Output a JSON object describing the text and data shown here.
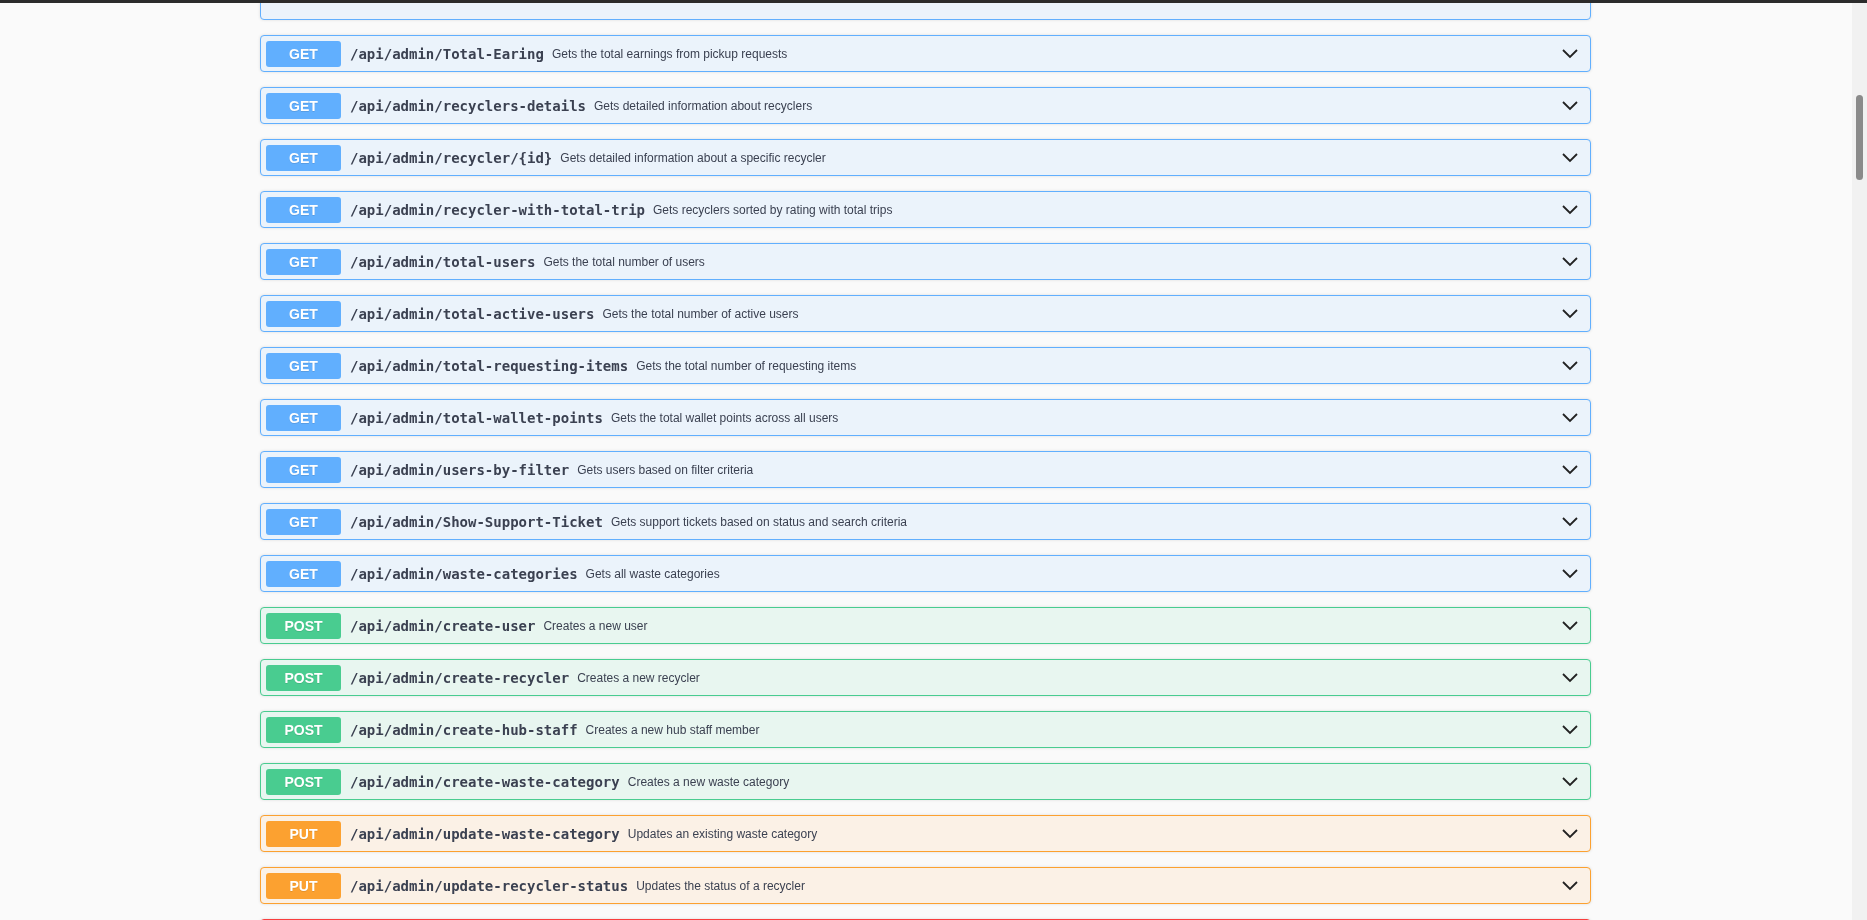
{
  "operations": [
    {
      "kind": "get"
    },
    {
      "kind": "get",
      "method": "GET",
      "path": "/api/admin/Total-Earing",
      "description": "Gets the total earnings from pickup requests"
    },
    {
      "kind": "get",
      "method": "GET",
      "path": "/api/admin/recyclers-details",
      "description": "Gets detailed information about recyclers"
    },
    {
      "kind": "get",
      "method": "GET",
      "path": "/api/admin/recycler/{id}",
      "description": "Gets detailed information about a specific recycler"
    },
    {
      "kind": "get",
      "method": "GET",
      "path": "/api/admin/recycler-with-total-trip",
      "description": "Gets recyclers sorted by rating with total trips"
    },
    {
      "kind": "get",
      "method": "GET",
      "path": "/api/admin/total-users",
      "description": "Gets the total number of users"
    },
    {
      "kind": "get",
      "method": "GET",
      "path": "/api/admin/total-active-users",
      "description": "Gets the total number of active users"
    },
    {
      "kind": "get",
      "method": "GET",
      "path": "/api/admin/total-requesting-items",
      "description": "Gets the total number of requesting items"
    },
    {
      "kind": "get",
      "method": "GET",
      "path": "/api/admin/total-wallet-points",
      "description": "Gets the total wallet points across all users"
    },
    {
      "kind": "get",
      "method": "GET",
      "path": "/api/admin/users-by-filter",
      "description": "Gets users based on filter criteria"
    },
    {
      "kind": "get",
      "method": "GET",
      "path": "/api/admin/Show-Support-Ticket",
      "description": "Gets support tickets based on status and search criteria"
    },
    {
      "kind": "get",
      "method": "GET",
      "path": "/api/admin/waste-categories",
      "description": "Gets all waste categories"
    },
    {
      "kind": "post",
      "method": "POST",
      "path": "/api/admin/create-user",
      "description": "Creates a new user"
    },
    {
      "kind": "post",
      "method": "POST",
      "path": "/api/admin/create-recycler",
      "description": "Creates a new recycler"
    },
    {
      "kind": "post",
      "method": "POST",
      "path": "/api/admin/create-hub-staff",
      "description": "Creates a new hub staff member"
    },
    {
      "kind": "post",
      "method": "POST",
      "path": "/api/admin/create-waste-category",
      "description": "Creates a new waste category"
    },
    {
      "kind": "put",
      "method": "PUT",
      "path": "/api/admin/update-waste-category",
      "description": "Updates an existing waste category"
    },
    {
      "kind": "put",
      "method": "PUT",
      "path": "/api/admin/update-recycler-status",
      "description": "Updates the status of a recycler"
    },
    {
      "kind": "delete"
    }
  ]
}
